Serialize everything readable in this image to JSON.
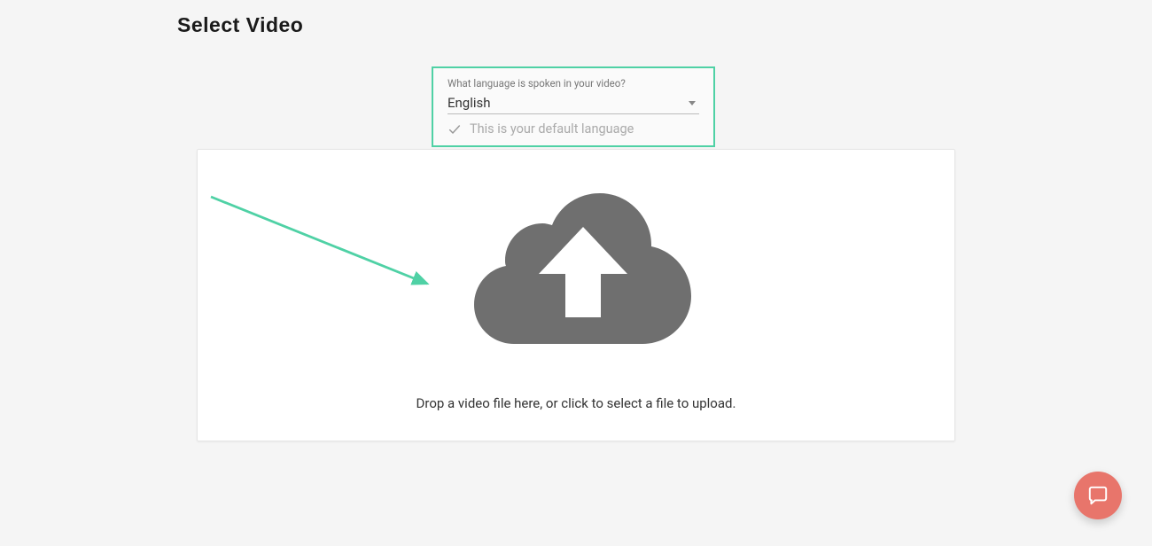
{
  "header": {
    "title": "Select Video"
  },
  "language": {
    "prompt": "What language is spoken in your video?",
    "selected": "English",
    "default_hint": "This is your default language"
  },
  "upload": {
    "instruction": "Drop a video file here, or click to select a file to upload."
  },
  "colors": {
    "accent": "#4fd1a5",
    "fab": "#e8756b",
    "icon_gray": "#6f6f6f"
  }
}
